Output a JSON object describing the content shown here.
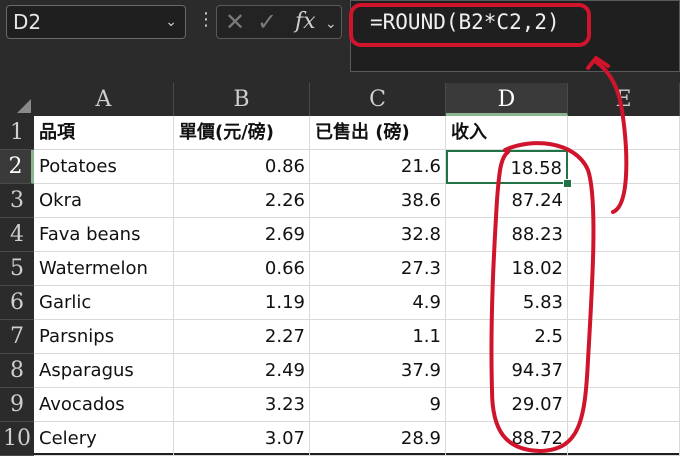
{
  "namebox": {
    "value": "D2"
  },
  "formula_bar": {
    "formula": "=ROUND(B2*C2,2)",
    "fx_label": "fx",
    "cancel_icon": "✕",
    "enter_icon": "✓"
  },
  "columns": [
    "A",
    "B",
    "C",
    "D",
    "E"
  ],
  "rows": [
    "1",
    "2",
    "3",
    "4",
    "5",
    "6",
    "7",
    "8",
    "9",
    "10"
  ],
  "header_row": [
    "品項",
    "單價(元/磅)",
    "已售出 (磅)",
    "收入"
  ],
  "data_rows": [
    [
      "Potatoes",
      "0.86",
      "21.6",
      "18.58"
    ],
    [
      "Okra",
      "2.26",
      "38.6",
      "87.24"
    ],
    [
      "Fava beans",
      "2.69",
      "32.8",
      "88.23"
    ],
    [
      "Watermelon",
      "0.66",
      "27.3",
      "18.02"
    ],
    [
      "Garlic",
      "1.19",
      "4.9",
      "5.83"
    ],
    [
      "Parsnips",
      "2.27",
      "1.1",
      "2.5"
    ],
    [
      "Asparagus",
      "2.49",
      "37.9",
      "94.37"
    ],
    [
      "Avocados",
      "3.23",
      "9",
      "29.07"
    ],
    [
      "Celery",
      "3.07",
      "28.9",
      "88.72"
    ]
  ],
  "selected_cell": "D2",
  "annotation_color": "#d0142c"
}
